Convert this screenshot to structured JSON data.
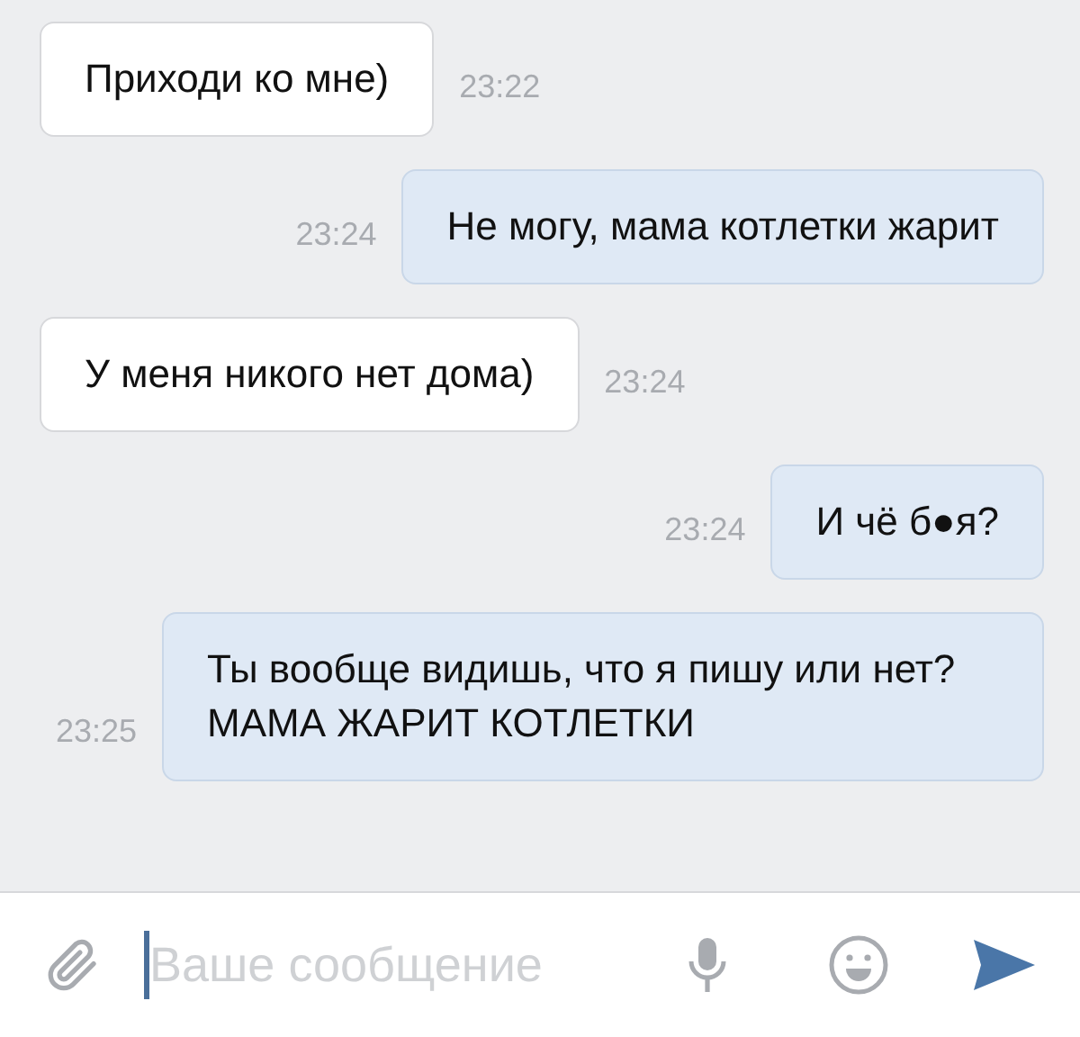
{
  "messages": [
    {
      "kind": "incoming",
      "text": "Приходи ко мне)",
      "time": "23:22"
    },
    {
      "kind": "outgoing",
      "text": "Не могу, мама котлетки жарит",
      "time": "23:24"
    },
    {
      "kind": "incoming",
      "text": "У меня никого нет дома)",
      "time": "23:24"
    },
    {
      "kind": "outgoing",
      "text": "И чё б●я?",
      "time": "23:24"
    },
    {
      "kind": "outgoing",
      "text": "Ты вообще видишь, что я пишу или нет? МАМА ЖАРИТ КОТЛЕТКИ",
      "time": "23:25"
    }
  ],
  "composer": {
    "placeholder": "Ваше сообщение"
  }
}
